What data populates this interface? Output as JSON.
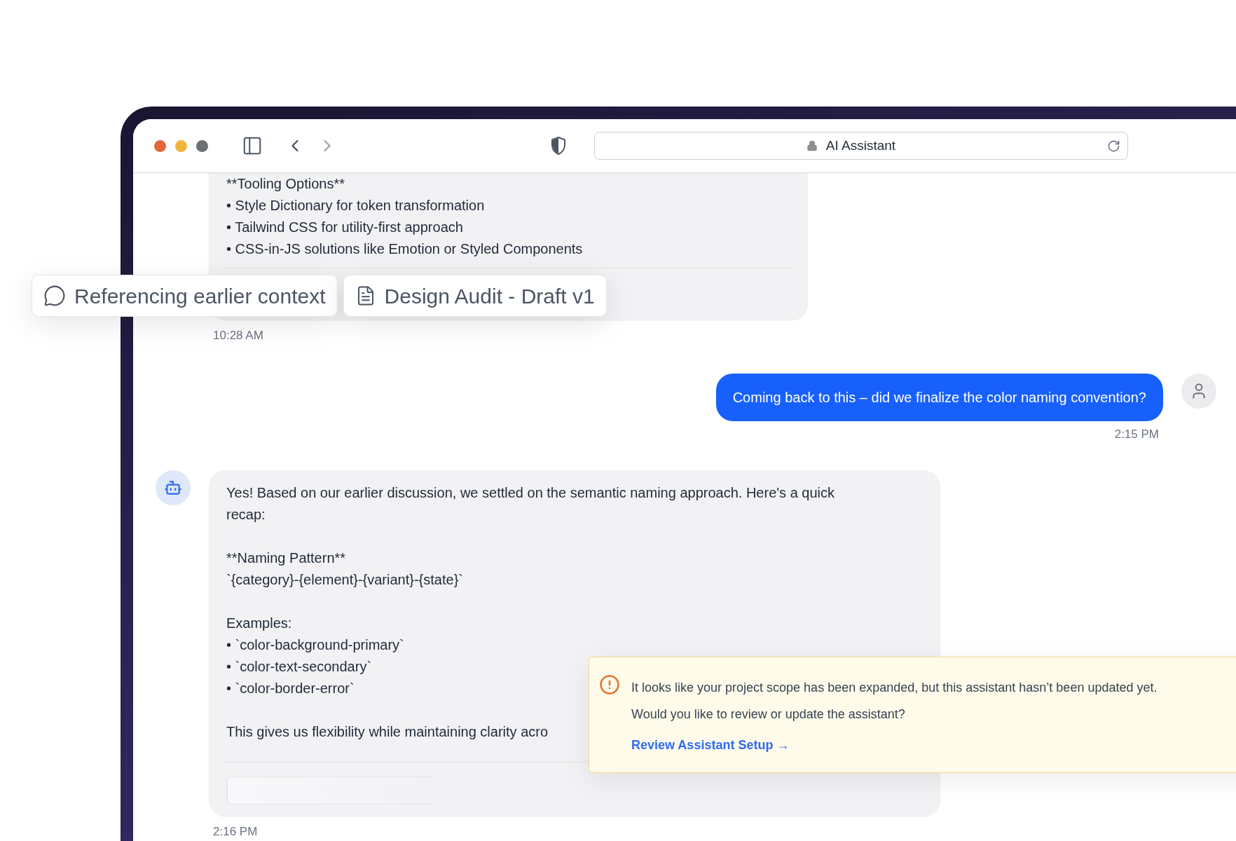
{
  "browser": {
    "address": "AI Assistant"
  },
  "messages": [
    {
      "kind": "assistant",
      "paragraphs": [
        [
          "**Tooling Options**",
          "• Style Dictionary for token transformation",
          "• Tailwind CSS for utility-first approach",
          "• CSS-in-JS solutions like Emotion or Styled Components"
        ]
      ],
      "time": "10:28 AM"
    },
    {
      "kind": "user",
      "avatar": true,
      "text": "Coming back to this – did we finalize the color naming convention?",
      "time": "2:15 PM"
    },
    {
      "kind": "assistant",
      "avatar": true,
      "paragraphs": [
        [
          "Yes! Based on our earlier discussion, we settled on the semantic naming approach. Here's a quick recap:"
        ],
        [
          "**Naming Pattern**",
          "`{category}-{element}-{variant}-{state}`"
        ],
        [
          "Examples:",
          "• `color-background-primary`",
          "• `color-text-secondary`",
          "• `color-border-error`"
        ],
        [
          "This gives us flexibility while maintaining clarity acro"
        ]
      ],
      "attachment": true,
      "time": "2:16 PM"
    }
  ],
  "context_chips": [
    {
      "kind": "message",
      "label": "Referencing earlier context"
    },
    {
      "kind": "document",
      "label": "Design Audit - Draft v1"
    }
  ],
  "alert": {
    "text": "It looks like your project scope has been expanded, but this assistant hasn’t been updated yet.",
    "question": "Would you like to review or update the assistant?",
    "link": "Review Assistant Setup →"
  }
}
